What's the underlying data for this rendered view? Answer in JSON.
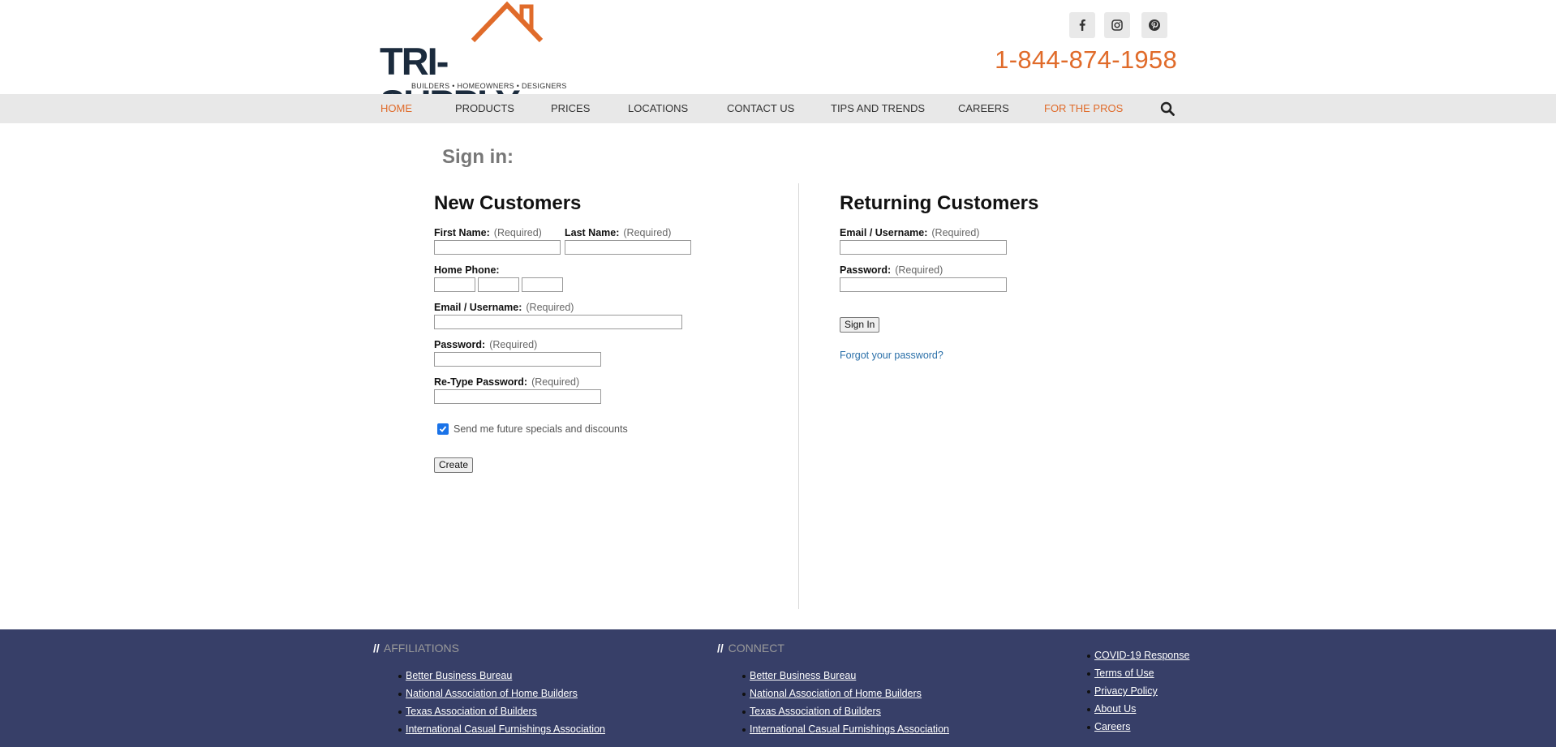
{
  "header": {
    "logo": {
      "brand": "TRI-SUPPLY",
      "tagline": "BUILDERS • HOMEOWNERS • DESIGNERS"
    },
    "phone": "1-844-874-1958",
    "social": [
      "facebook-icon",
      "instagram-icon",
      "pinterest-icon"
    ],
    "colors": {
      "accent": "#e06b2a",
      "brand": "#1b2b3d",
      "nav_bg": "#e8e8e8",
      "footer_bg": "#373f68"
    }
  },
  "nav": {
    "items": [
      {
        "label": "HOME"
      },
      {
        "label": "PRODUCTS"
      },
      {
        "label": "PRICES"
      },
      {
        "label": "LOCATIONS"
      },
      {
        "label": "CONTACT US"
      },
      {
        "label": "TIPS AND TRENDS"
      },
      {
        "label": "CAREERS"
      },
      {
        "label": "FOR THE PROS"
      }
    ]
  },
  "page": {
    "title": "Sign in:"
  },
  "new_customers": {
    "title": "New Customers",
    "required_note": "(Required)",
    "first_name_label": "First Name:",
    "last_name_label": "Last Name:",
    "home_phone_label": "Home Phone:",
    "email_label": "Email / Username:",
    "password_label": "Password:",
    "retype_label": "Re-Type Password:",
    "specials_label": "Send me future specials and discounts",
    "specials_checked": true,
    "create_button": "Create"
  },
  "returning_customers": {
    "title": "Returning Customers",
    "required_note": "(Required)",
    "email_label": "Email / Username:",
    "password_label": "Password:",
    "signin_button": "Sign In",
    "forgot_link": "Forgot your password?"
  },
  "footer": {
    "affiliations": {
      "heading": "AFFILIATIONS",
      "links": [
        "Better Business Bureau",
        "National Association of Home Builders",
        "Texas Association of Builders",
        "International Casual Furnishings Association"
      ]
    },
    "connect": {
      "heading": "CONNECT",
      "links": [
        "Better Business Bureau",
        "National Association of Home Builders",
        "Texas Association of Builders",
        "International Casual Furnishings Association"
      ]
    },
    "legal": {
      "links": [
        "COVID-19 Response",
        "Terms of Use",
        "Privacy Policy",
        "About Us",
        "Careers"
      ]
    }
  }
}
